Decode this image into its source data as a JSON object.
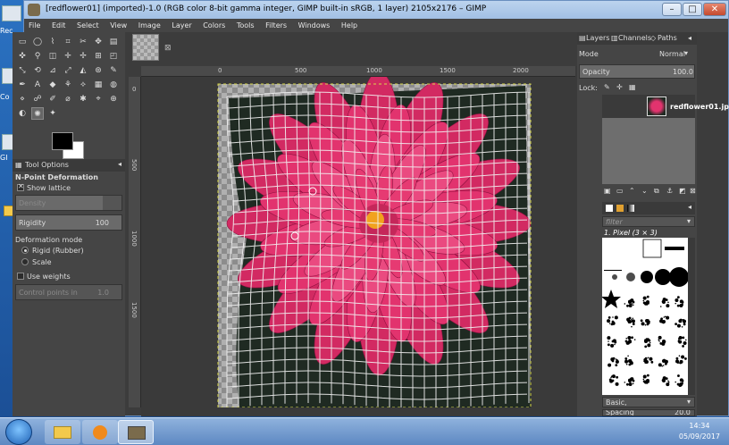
{
  "desktop": {
    "icons": [
      "Rec",
      "Co",
      "GI"
    ]
  },
  "window": {
    "title": "[redflower01] (imported)-1.0 (RGB color 8-bit gamma integer, GIMP built-in sRGB, 1 layer) 2105x2176 – GIMP",
    "buttons": {
      "minimize": "–",
      "maximize": "□",
      "close": "✕"
    }
  },
  "menubar": [
    "File",
    "Edit",
    "Select",
    "View",
    "Image",
    "Layer",
    "Colors",
    "Tools",
    "Filters",
    "Windows",
    "Help"
  ],
  "tool_options": {
    "tab_label": "Tool Options",
    "title": "N-Point Deformation",
    "show_lattice_label": "Show lattice",
    "show_lattice_checked": true,
    "density": {
      "label": "Density",
      "value": "",
      "level": 0.82
    },
    "rigidity": {
      "label": "Rigidity",
      "value": "100",
      "level": 1.0
    },
    "deformation_mode_label": "Deformation mode",
    "rigid_label": "Rigid (Rubber)",
    "scale_label": "Scale",
    "use_weights_label": "Use weights",
    "control_points_label": "Control points in",
    "control_points_value": "1.0"
  },
  "rulers": {
    "h_labels": [
      "0",
      "500",
      "1000",
      "1500",
      "2000"
    ],
    "v_labels": [
      "0",
      "500",
      "1000",
      "1500"
    ]
  },
  "layers_panel": {
    "tabs": [
      "Layers",
      "Channels",
      "Paths"
    ],
    "mode_label": "Mode",
    "mode_value": "Normal",
    "opacity_label": "Opacity",
    "opacity_value": "100.0",
    "lock_label": "Lock:",
    "layer_name": "redflower01.jp"
  },
  "brushes_panel": {
    "filter_label": "filter",
    "brush_title": "1. Pixel (3 × 3)",
    "preset_label": "Basic,",
    "spacing_label": "Spacing",
    "spacing_value": "20.0"
  },
  "taskbar": {
    "time": "14:34",
    "date": "05/09/2017"
  },
  "colors": {
    "accent": "#e2336e",
    "panel": "#454545",
    "lattice": "#f2f2f2"
  }
}
